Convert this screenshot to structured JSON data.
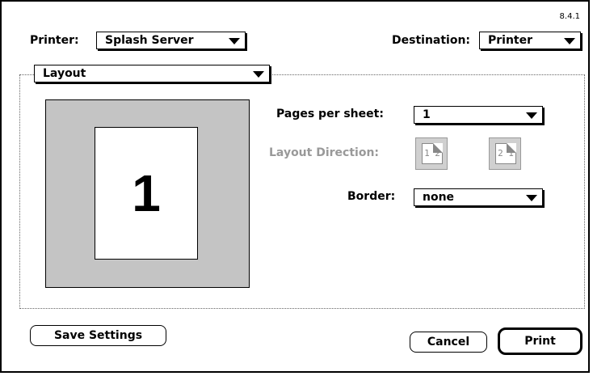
{
  "dialog": {
    "version": "8.4.1",
    "printer": {
      "label": "Printer:",
      "value": "Splash Server"
    },
    "destination": {
      "label": "Destination:",
      "value": "Printer"
    },
    "panel_menu": {
      "value": "Layout"
    },
    "preview": {
      "page_number": "1"
    },
    "pages_per_sheet": {
      "label": "Pages per sheet:",
      "value": "1"
    },
    "layout_direction": {
      "label": "Layout Direction:",
      "option_ltr": "1 2",
      "option_rtl": "2 1"
    },
    "border": {
      "label": "Border:",
      "value": "none"
    },
    "buttons": {
      "save_settings": "Save Settings",
      "cancel": "Cancel",
      "print": "Print"
    },
    "colors": {
      "preview_bg": "#c4c4c4",
      "disabled_text": "#999999"
    }
  }
}
